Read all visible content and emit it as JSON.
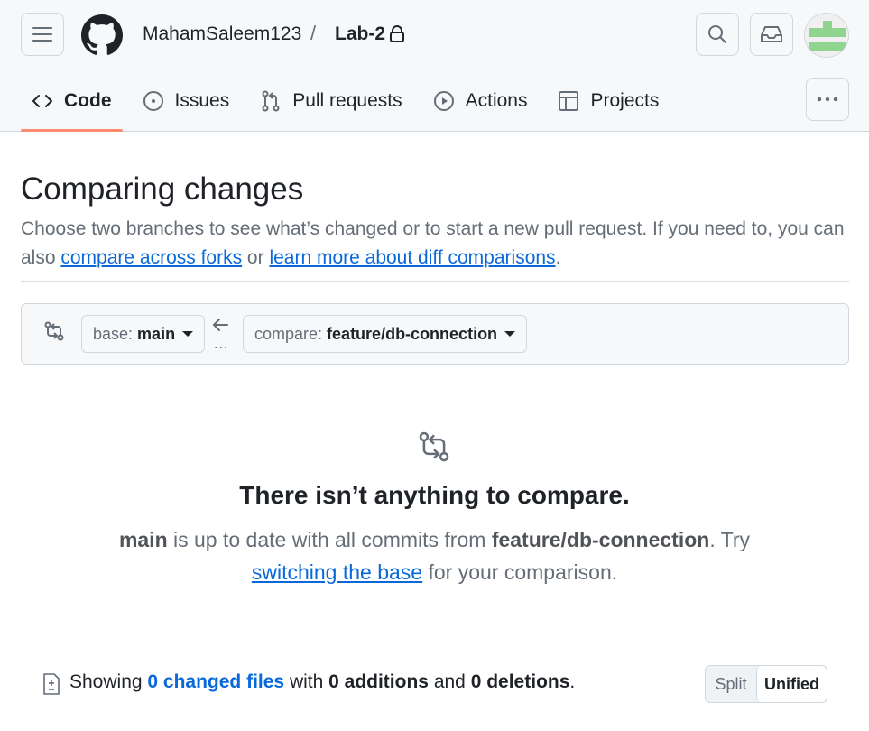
{
  "header": {
    "owner": "MahamSaleem123",
    "separator": "/",
    "repo": "Lab-2",
    "icons": [
      "hamburger-menu-icon",
      "github-logo-icon",
      "lock-icon",
      "search-icon",
      "inbox-icon",
      "avatar"
    ]
  },
  "tabs": [
    {
      "label": "Code",
      "icon": "code-icon",
      "active": true
    },
    {
      "label": "Issues",
      "icon": "issue-opened-icon",
      "active": false
    },
    {
      "label": "Pull requests",
      "icon": "git-pull-request-icon",
      "active": false
    },
    {
      "label": "Actions",
      "icon": "play-icon",
      "active": false
    },
    {
      "label": "Projects",
      "icon": "table-icon",
      "active": false
    }
  ],
  "page": {
    "title": "Comparing changes",
    "description_start": "Choose two branches to see what’s changed or to start a new pull request. If you need to, you can also ",
    "link_forks": "compare across forks",
    "description_mid": " or ",
    "link_learn": "learn more about diff comparisons",
    "description_end": "."
  },
  "range": {
    "base_label": "base:",
    "base_value": "main",
    "compare_label": "compare:",
    "compare_value": "feature/db-connection",
    "dots": "..."
  },
  "blankslate": {
    "title": "There isn’t anything to compare.",
    "branch_a": "main",
    "text_mid": " is up to date with all commits from ",
    "branch_b": "feature/db-connection",
    "text_try": ". Try ",
    "link": "switching the base",
    "text_end": " for your comparison."
  },
  "toolbar": {
    "showing": "Showing ",
    "changed_files": "0 changed files",
    "with": " with ",
    "additions": "0 additions",
    "and": " and ",
    "deletions": "0 deletions",
    "end": ".",
    "split_label": "Split",
    "unified_label": "Unified"
  },
  "colors": {
    "accent_link": "#0969da",
    "active_tab_underline": "#fd8c73",
    "header_bg": "#f6f8fa"
  }
}
